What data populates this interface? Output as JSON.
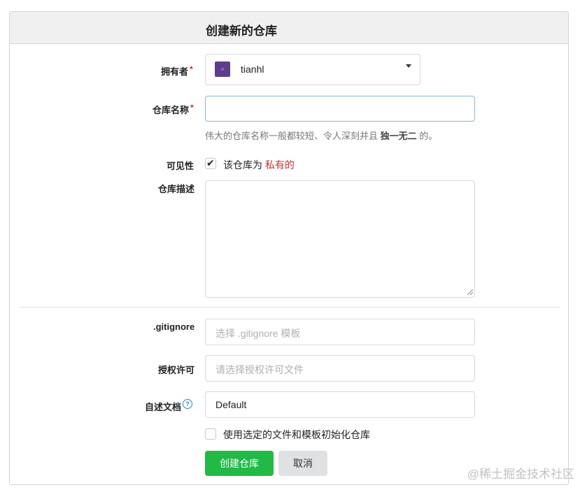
{
  "header": {
    "title": "创建新的仓库"
  },
  "owner": {
    "label": "拥有者",
    "required_mark": "*",
    "value": "tianhl"
  },
  "repo_name": {
    "label": "仓库名称",
    "required_mark": "*",
    "value": "",
    "help_prefix": "伟大的仓库名称一般都较短、令人深刻并且 ",
    "help_bold": "独一无二",
    "help_suffix": " 的。"
  },
  "visibility": {
    "label": "可见性",
    "checked": true,
    "text_prefix": "该仓库为 ",
    "text_private": "私有的"
  },
  "description": {
    "label": "仓库描述",
    "value": ""
  },
  "gitignore": {
    "label": ".gitignore",
    "placeholder": "选择 .gitignore 模板"
  },
  "license": {
    "label": "授权许可",
    "placeholder": "请选择授权许可文件"
  },
  "readme": {
    "label": "自述文档",
    "value": "Default",
    "help_icon": "question-circle-icon"
  },
  "auto_init": {
    "checked": false,
    "label": "使用选定的文件和模板初始化仓库"
  },
  "actions": {
    "create_label": "创建仓库",
    "cancel_label": "取消"
  },
  "colors": {
    "primary": "#21ba45",
    "required": "#db2828",
    "private": "#db2828",
    "header_bg": "#f0f0f0"
  },
  "watermark": "@稀土掘金技术社区"
}
